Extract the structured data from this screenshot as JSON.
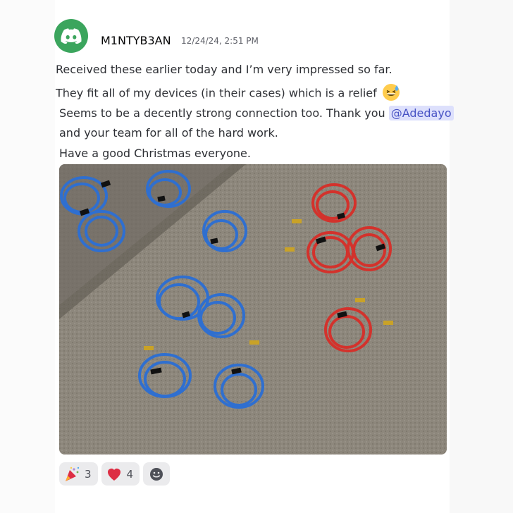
{
  "message": {
    "username": "M1NTYB3AN",
    "timestamp": "12/24/24, 2:51 PM",
    "lines": [
      "Received these earlier today and I’m very impressed so far.",
      "They fit all of my devices (in their cases) which is a relief",
      "Seems to be a decently strong connection too. Thank you ",
      "and your team for all of the hard work.",
      "Have a good Christmas everyone."
    ],
    "mention": "@Adedayo",
    "inline_emoji": "sweat-smile-emoji"
  },
  "attachment": {
    "description_icon": "photo-attachment",
    "cable_colors": {
      "blue": "#2f6fd0",
      "red": "#d3322c",
      "carpet": "#8d877c"
    }
  },
  "reactions": [
    {
      "emoji": "party-popper-icon",
      "count": "3"
    },
    {
      "emoji": "red-heart-icon",
      "count": "4"
    },
    {
      "emoji": "add-reaction-icon",
      "count": ""
    }
  ],
  "colors": {
    "discord_green": "#3ba55d",
    "mention_bg": "#dde0fc",
    "mention_text": "#4752c4"
  }
}
